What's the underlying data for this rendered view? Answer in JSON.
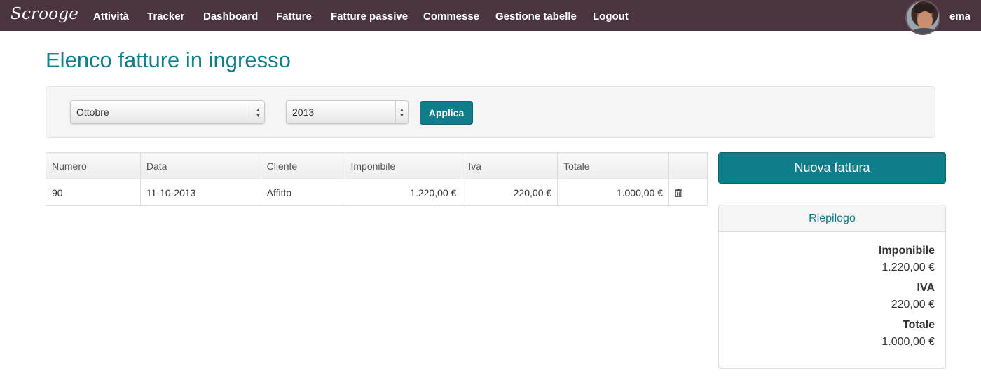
{
  "navbar": {
    "brand": "Scrooge",
    "items": [
      "Attività",
      "Tracker",
      "Dashboard",
      "Fatture",
      "Fatture passive",
      "Commesse",
      "Gestione tabelle",
      "Logout"
    ],
    "user": "ema",
    "background": "#4a3440"
  },
  "page": {
    "title": "Elenco fatture in ingresso",
    "accent_color": "#0e7e8a"
  },
  "filter": {
    "month": "Ottobre",
    "year": "2013",
    "apply_label": "Applica"
  },
  "table": {
    "headers": [
      "Numero",
      "Data",
      "Cliente",
      "Imponibile",
      "Iva",
      "Totale",
      ""
    ],
    "rows": [
      {
        "numero": "90",
        "data": "11-10-2013",
        "cliente": "Affitto",
        "imponibile": "1.220,00 €",
        "iva": "220,00 €",
        "totale": "1.000,00 €",
        "action_icon": "trash-icon"
      }
    ]
  },
  "sidebar": {
    "new_invoice_label": "Nuova fattura",
    "summary": {
      "title": "Riepilogo",
      "imponibile_label": "Imponibile",
      "imponibile_value": "1.220,00 €",
      "iva_label": "IVA",
      "iva_value": "220,00 €",
      "totale_label": "Totale",
      "totale_value": "1.000,00 €"
    }
  }
}
